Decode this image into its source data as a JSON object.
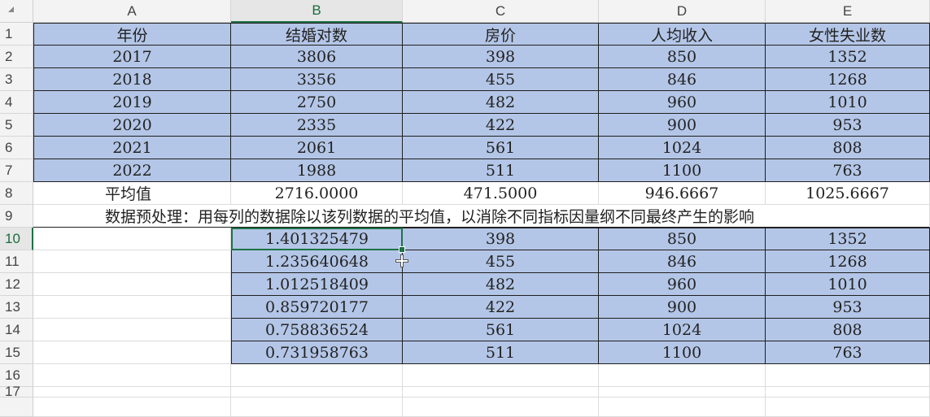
{
  "columns": [
    "A",
    "B",
    "C",
    "D",
    "E"
  ],
  "active_column": "B",
  "active_row": "10",
  "row_numbers": [
    "1",
    "2",
    "3",
    "4",
    "5",
    "6",
    "7",
    "8",
    "9",
    "10",
    "11",
    "12",
    "13",
    "14",
    "15",
    "16",
    "17"
  ],
  "headers": [
    "年份",
    "结婚对数",
    "房价",
    "人均收入",
    "女性失业数"
  ],
  "data_rows": [
    [
      "2017",
      "3806",
      "398",
      "850",
      "1352"
    ],
    [
      "2018",
      "3356",
      "455",
      "846",
      "1268"
    ],
    [
      "2019",
      "2750",
      "482",
      "960",
      "1010"
    ],
    [
      "2020",
      "2335",
      "422",
      "900",
      "953"
    ],
    [
      "2021",
      "2061",
      "561",
      "1024",
      "808"
    ],
    [
      "2022",
      "1988",
      "511",
      "1100",
      "763"
    ]
  ],
  "average_row": [
    "平均值",
    "2716.0000",
    "471.5000",
    "946.6667",
    "1025.6667"
  ],
  "note": "数据预处理：用每列的数据除以该列数据的平均值，以消除不同指标因量纲不同最终产生的影响",
  "processed_rows": [
    [
      "1.401325479",
      "398",
      "850",
      "1352"
    ],
    [
      "1.235640648",
      "455",
      "846",
      "1268"
    ],
    [
      "1.012518409",
      "482",
      "960",
      "1010"
    ],
    [
      "0.859720177",
      "422",
      "900",
      "953"
    ],
    [
      "0.758836524",
      "561",
      "1024",
      "808"
    ],
    [
      "0.731958763",
      "511",
      "1100",
      "763"
    ]
  ],
  "selected_cell": "B10",
  "colors": {
    "table_fill": "#b4c6e7",
    "selection": "#1e7145",
    "header_bg": "#f3f3f3"
  }
}
